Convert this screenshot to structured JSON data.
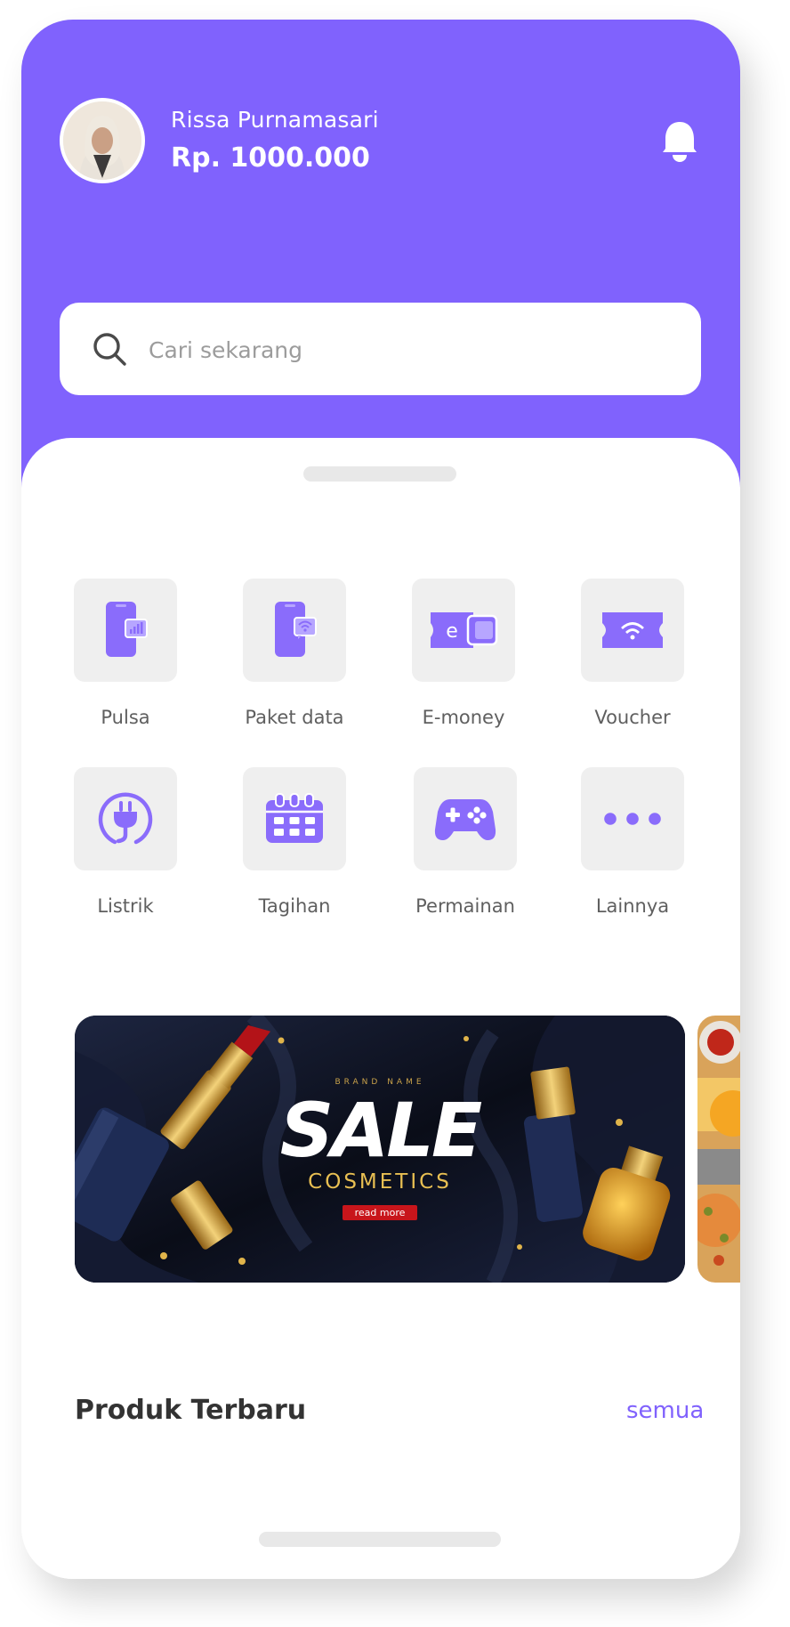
{
  "user": {
    "name": "Rissa Purnamasari",
    "balance": "Rp. 1000.000"
  },
  "search": {
    "placeholder": "Cari sekarang",
    "value": ""
  },
  "services": [
    {
      "label": "Pulsa",
      "icon": "phone-signal-icon"
    },
    {
      "label": "Paket data",
      "icon": "phone-wifi-icon"
    },
    {
      "label": "E-money",
      "icon": "e-wallet-icon"
    },
    {
      "label": "Voucher",
      "icon": "wifi-ticket-icon"
    },
    {
      "label": "Listrik",
      "icon": "power-plug-icon"
    },
    {
      "label": "Tagihan",
      "icon": "calendar-icon"
    },
    {
      "label": "Permainan",
      "icon": "gamepad-icon"
    },
    {
      "label": "Lainnya",
      "icon": "more-dots-icon"
    }
  ],
  "banner": {
    "brand": "BRAND NAME",
    "headline": "SALE",
    "subline": "COSMETICS",
    "cta": "read more"
  },
  "products_section": {
    "title": "Produk Terbaru",
    "see_all": "semua"
  },
  "colors": {
    "primary": "#8062fd",
    "tile_bg": "#efefef",
    "text_dark": "#333333",
    "text_muted": "#5f5f5f"
  }
}
